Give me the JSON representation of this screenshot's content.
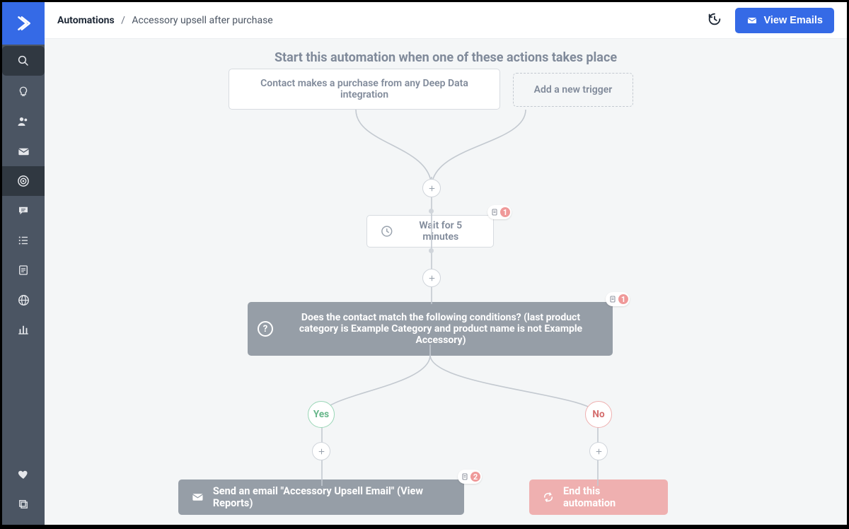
{
  "breadcrumb": {
    "section": "Automations",
    "page": "Accessory upsell after purchase"
  },
  "header": {
    "view_emails": "View Emails"
  },
  "canvas": {
    "headline": "Start this automation when one of these actions takes place",
    "trigger1": "Contact makes a purchase from any Deep Data integration",
    "add_trigger": "Add a new trigger",
    "wait": "Wait for 5 minutes",
    "condition": "Does the contact match the following conditions? (last product category is Example Category and product name is not Example Accessory)",
    "yes": "Yes",
    "no": "No",
    "send_email": "Send an email \"Accessory Upsell Email\" (View Reports)",
    "end_automation": "End this automation",
    "badges": {
      "b1": "1",
      "b2": "1",
      "b3": "2"
    }
  }
}
